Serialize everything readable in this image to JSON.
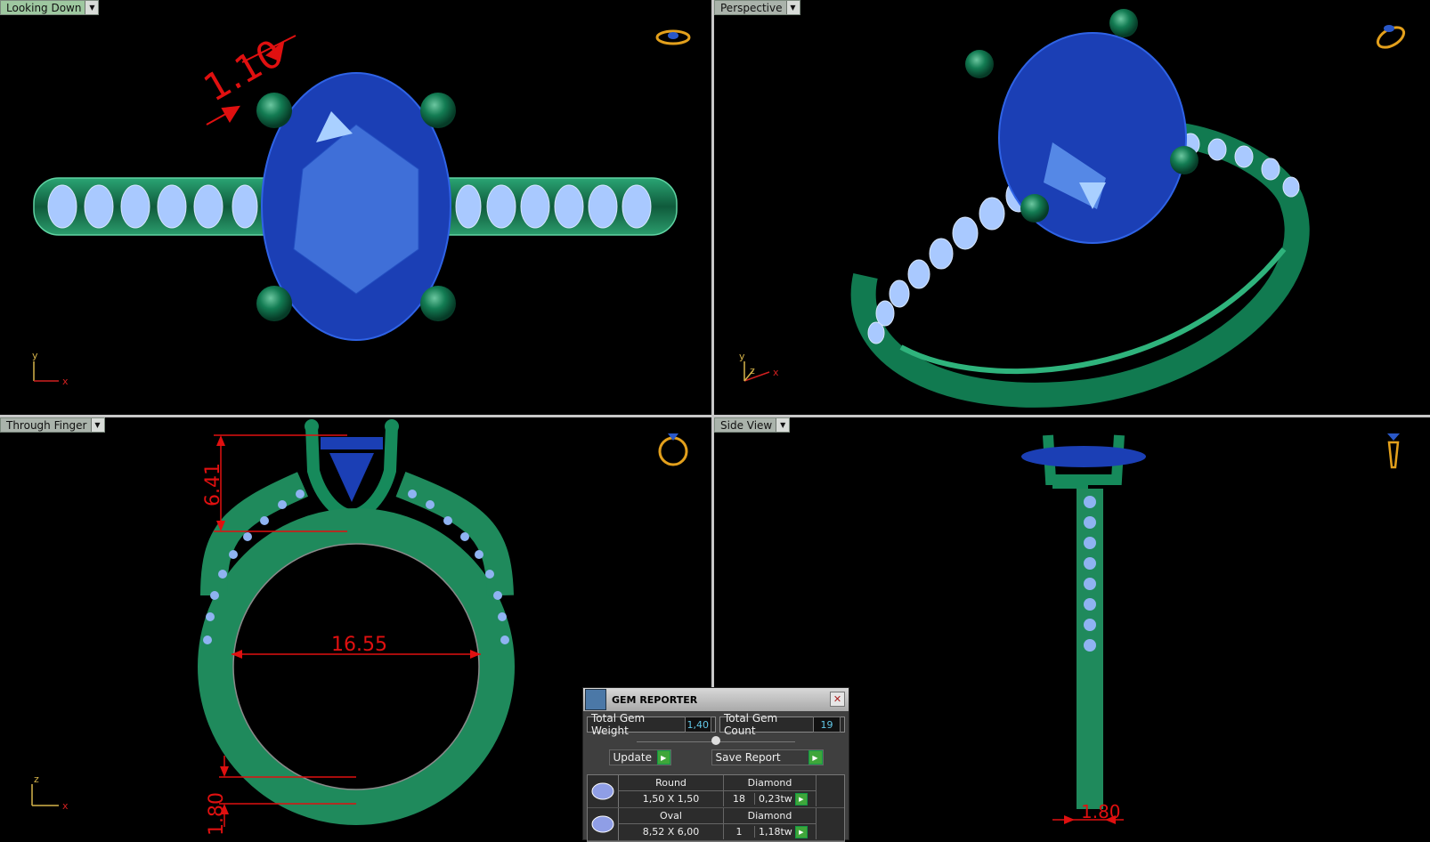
{
  "viewports": {
    "top_left": {
      "label": "Looking Down",
      "dimension": "1.10"
    },
    "top_right": {
      "label": "Perspective"
    },
    "bottom_left": {
      "label": "Through Finger",
      "dim_height": "6.41",
      "dim_inner": "16.55",
      "dim_band": "1.80"
    },
    "bottom_right": {
      "label": "Side View",
      "dim_band": "1.80"
    }
  },
  "axes": {
    "x": "x",
    "y": "y",
    "z": "z"
  },
  "gem_reporter": {
    "title": "GEM REPORTER",
    "close": "✕",
    "total_weight_label": "Total Gem Weight",
    "total_weight_value": "1,40",
    "total_count_label": "Total Gem Count",
    "total_count_value": "19",
    "update_label": "Update",
    "save_label": "Save Report",
    "gems": [
      {
        "shape": "Round",
        "size": "1,50 X 1,50",
        "type": "Diamond",
        "count": "18",
        "weight": "0,23tw"
      },
      {
        "shape": "Oval",
        "size": "8,52 X 6,00",
        "type": "Diamond",
        "count": "1",
        "weight": "1,18tw"
      }
    ]
  },
  "colors": {
    "metal": "#1f8a5c",
    "gem": "#1b3fb5",
    "pave": "#8fb3f2",
    "dimension": "#e01010",
    "axis_x": "#d02020",
    "axis_y": "#d6b44a"
  },
  "icons": [
    "ring-orientation-icon"
  ]
}
